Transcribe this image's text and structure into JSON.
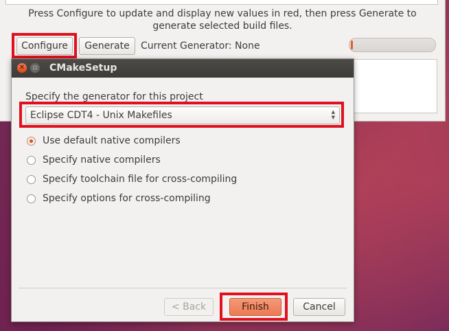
{
  "main_window": {
    "hint": "Press Configure to update and display new values in red, then press Generate to generate selected build files.",
    "configure_label": "Configure",
    "generate_label": "Generate",
    "generator_label": "Current Generator: None",
    "progress_fraction": 0.02
  },
  "dialog": {
    "title": "CMakeSetup",
    "prompt": "Specify the generator for this project",
    "generator_selected": "Eclipse CDT4 - Unix Makefiles",
    "options": [
      {
        "label": "Use default native compilers",
        "checked": true
      },
      {
        "label": "Specify native compilers",
        "checked": false
      },
      {
        "label": "Specify toolchain file for cross-compiling",
        "checked": false
      },
      {
        "label": "Specify options for cross-compiling",
        "checked": false
      }
    ],
    "back_label": "< Back",
    "finish_label": "Finish",
    "cancel_label": "Cancel"
  },
  "colors": {
    "highlight": "#e0101e",
    "accent": "#e0501c"
  }
}
